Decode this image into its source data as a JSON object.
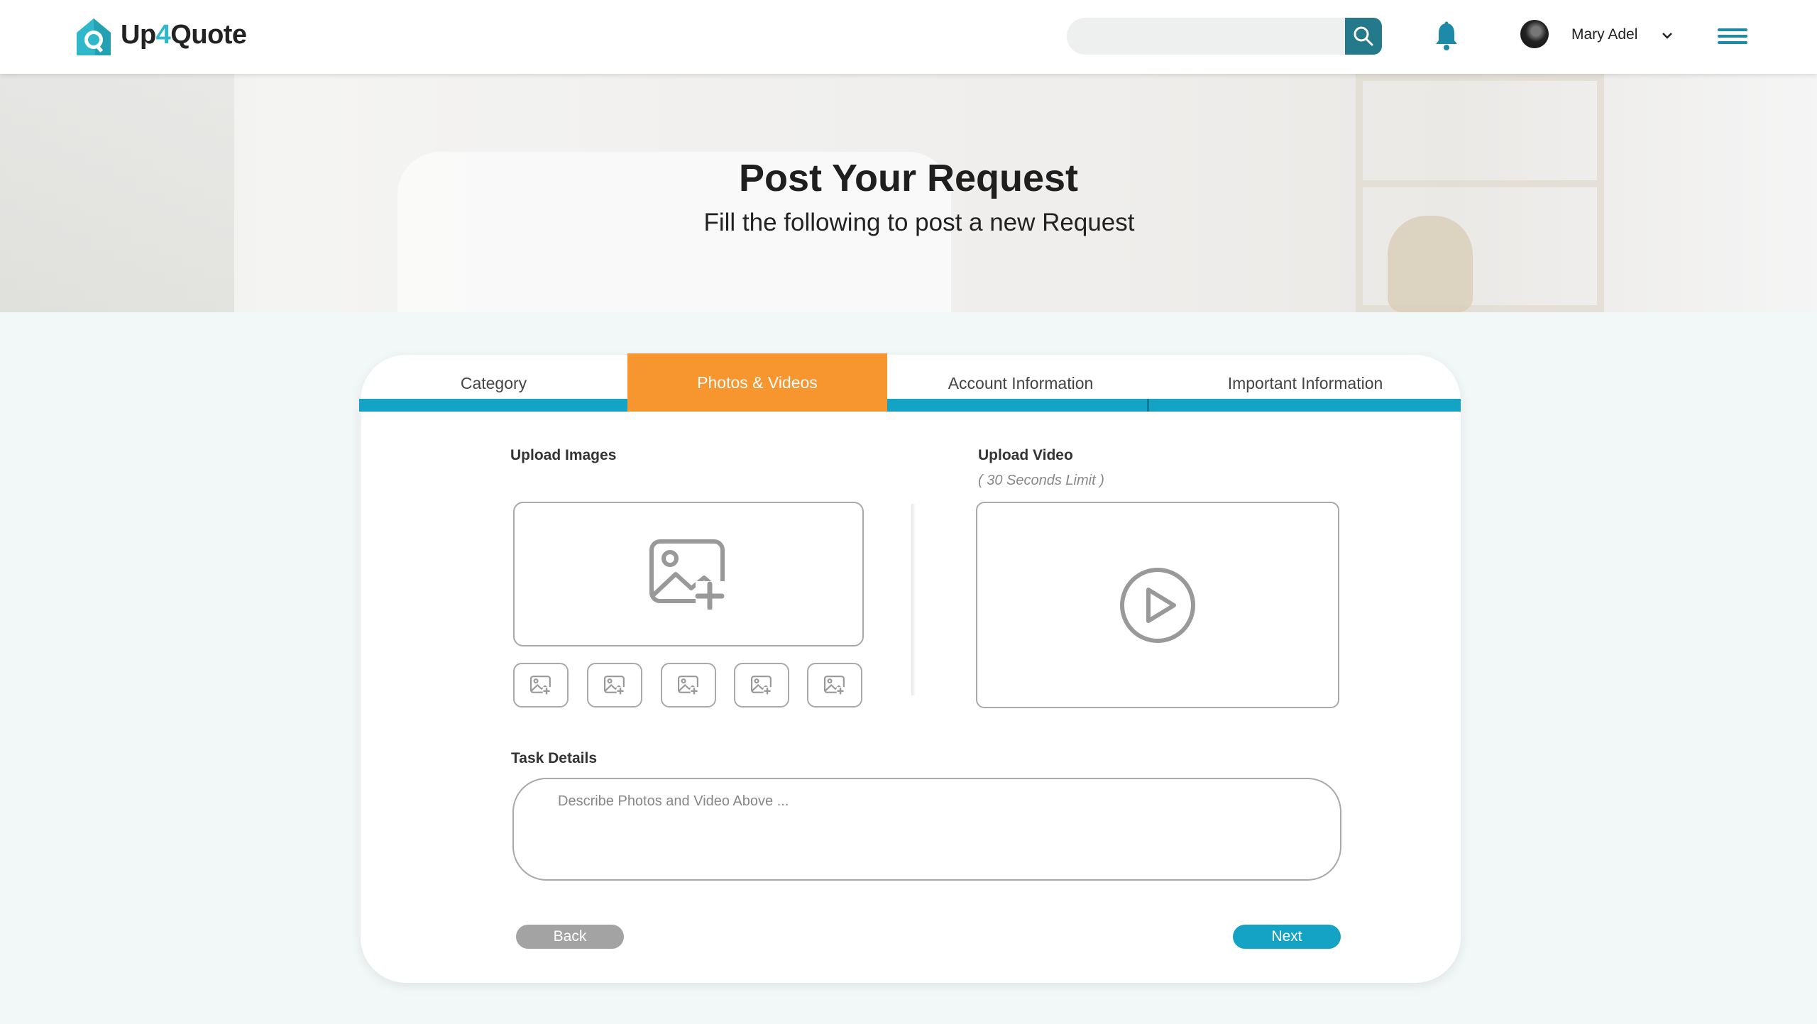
{
  "header": {
    "logo": {
      "text_before": "Up",
      "text_accent": "4",
      "text_after": "Quote"
    },
    "search": {
      "placeholder": ""
    },
    "user": {
      "name": "Mary Adel"
    },
    "icons": {
      "search": "search-icon",
      "notifications": "bell-icon",
      "dropdown": "chevron-down-icon",
      "menu": "hamburger-menu-icon"
    },
    "colors": {
      "brand_teal": "#2fb8c9",
      "search_button": "#24798a",
      "menu": "#1d8aa8"
    }
  },
  "hero": {
    "title": "Post Your Request",
    "subtitle": "Fill the following to post a new Request"
  },
  "wizard": {
    "tabs": [
      {
        "label": "Category",
        "active": false
      },
      {
        "label": "Photos & Videos",
        "active": true
      },
      {
        "label": "Account Information",
        "active": false
      },
      {
        "label": "Important Information",
        "active": false
      }
    ],
    "colors": {
      "active_tab": "#f7952f",
      "tab_bar": "#14a3c4",
      "next_button": "#14a3c4",
      "back_button": "#a3a3a3"
    },
    "upload_images": {
      "label": "Upload Images",
      "main_icon": "image-add-icon",
      "thumb_count": 5
    },
    "upload_video": {
      "label": "Upload Video",
      "hint": "( 30 Seconds Limit )",
      "icon": "play-icon"
    },
    "task_details": {
      "label": "Task Details",
      "placeholder": "Describe Photos and Video Above ...",
      "value": ""
    },
    "buttons": {
      "back": "Back",
      "next": "Next"
    }
  }
}
